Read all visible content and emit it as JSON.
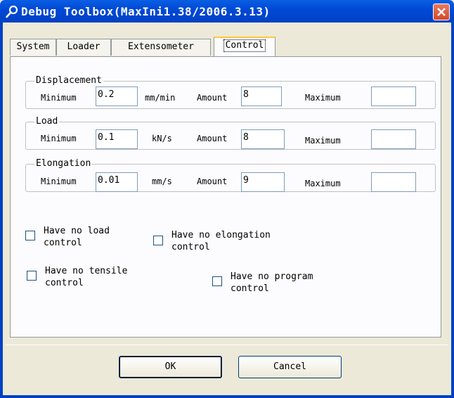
{
  "window": {
    "title": "Debug Toolbox(MaxIni1.38/2006.3.13)"
  },
  "tabs": [
    {
      "label": "System"
    },
    {
      "label": "Loader"
    },
    {
      "label": "Extensometer"
    },
    {
      "label": "Control",
      "active": true
    }
  ],
  "groups": [
    {
      "legend": "Displacement",
      "minimum_label": "Minimum",
      "minimum_value": "0.2",
      "unit": "mm/min",
      "amount_label": "Amount",
      "amount_value": "8",
      "maximum_label": "Maximum",
      "maximum_value": ""
    },
    {
      "legend": "Load",
      "minimum_label": "Minimum",
      "minimum_value": "0.1",
      "unit": "kN/s",
      "amount_label": "Amount",
      "amount_value": "8",
      "maximum_label": "Maximum",
      "maximum_value": ""
    },
    {
      "legend": "Elongation",
      "minimum_label": "Minimum",
      "minimum_value": "0.01",
      "unit": "mm/s",
      "amount_label": "Amount",
      "amount_value": "9",
      "maximum_label": "Maximum",
      "maximum_value": ""
    }
  ],
  "checkboxes": [
    {
      "line1": "Have no load",
      "line2": "control",
      "checked": false
    },
    {
      "line1": "Have no elongation",
      "line2": "control",
      "checked": false
    },
    {
      "line1": "Have no tensile",
      "line2": "control",
      "checked": false
    },
    {
      "line1": "Have no program",
      "line2": "control",
      "checked": false
    }
  ],
  "buttons": {
    "ok": "OK",
    "cancel": "Cancel"
  },
  "colors": {
    "titlebar": "#0049d6",
    "close_button": "#d34a2b",
    "dialog_bg": "#ece9d8",
    "active_tab_highlight": "#ffc83c"
  }
}
